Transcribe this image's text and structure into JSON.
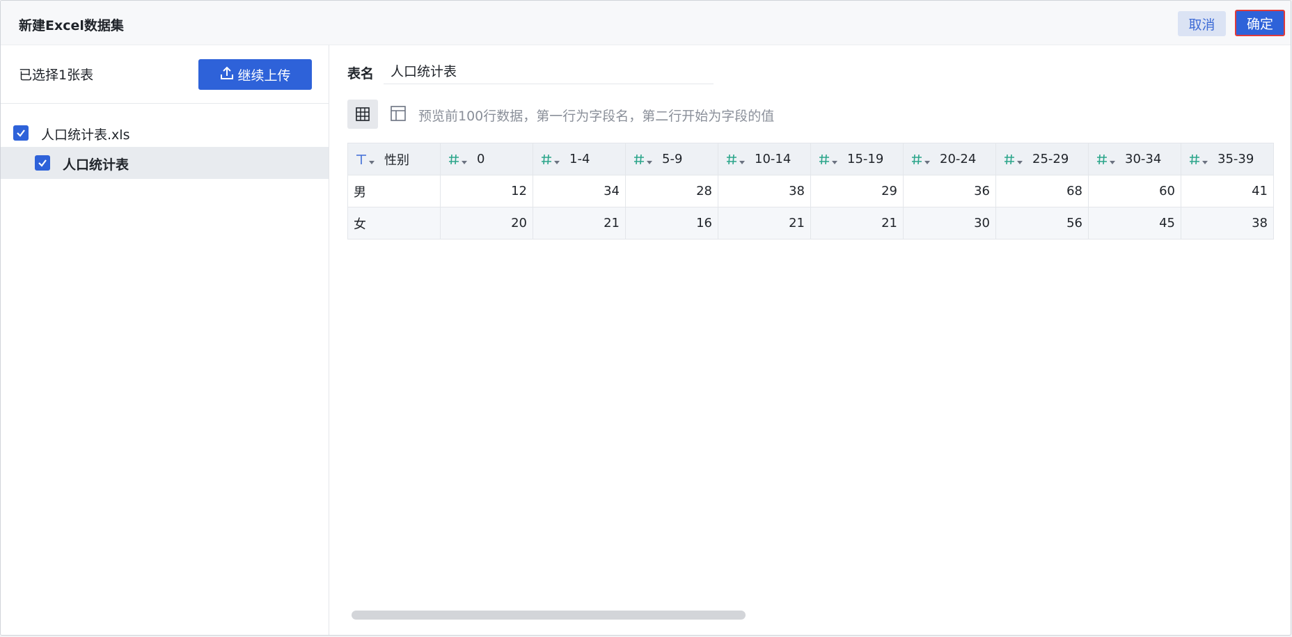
{
  "dialog": {
    "title": "新建Excel数据集",
    "cancel_label": "取消",
    "ok_label": "确定"
  },
  "left": {
    "selected_text": "已选择1张表",
    "upload_label": "继续上传",
    "tree": {
      "file_name": "人口统计表.xls",
      "sheet_name": "人口统计表"
    }
  },
  "right": {
    "table_name_label": "表名",
    "table_name_value": "人口统计表",
    "hint": "预览前100行数据，第一行为字段名，第二行开始为字段的值",
    "columns": [
      {
        "name": "性别",
        "type": "text"
      },
      {
        "name": "0",
        "type": "number"
      },
      {
        "name": "1-4",
        "type": "number"
      },
      {
        "name": "5-9",
        "type": "number"
      },
      {
        "name": "10-14",
        "type": "number"
      },
      {
        "name": "15-19",
        "type": "number"
      },
      {
        "name": "20-24",
        "type": "number"
      },
      {
        "name": "25-29",
        "type": "number"
      },
      {
        "name": "30-34",
        "type": "number"
      },
      {
        "name": "35-39",
        "type": "number"
      }
    ],
    "rows": [
      [
        "男",
        "12",
        "34",
        "28",
        "38",
        "29",
        "36",
        "68",
        "60",
        "41"
      ],
      [
        "女",
        "20",
        "21",
        "16",
        "21",
        "21",
        "30",
        "56",
        "45",
        "38"
      ]
    ]
  },
  "colors": {
    "primary": "#2e62d9",
    "number_type_icon": "#2aa58a",
    "text_type_icon": "#3d6bd6"
  },
  "icons": {
    "upload": "upload-icon",
    "grid_view": "table-grid-icon",
    "layout_view": "layout-icon",
    "text_type": "text-type-icon",
    "number_type": "hash-icon",
    "checkbox": "checkbox-checked-icon"
  }
}
